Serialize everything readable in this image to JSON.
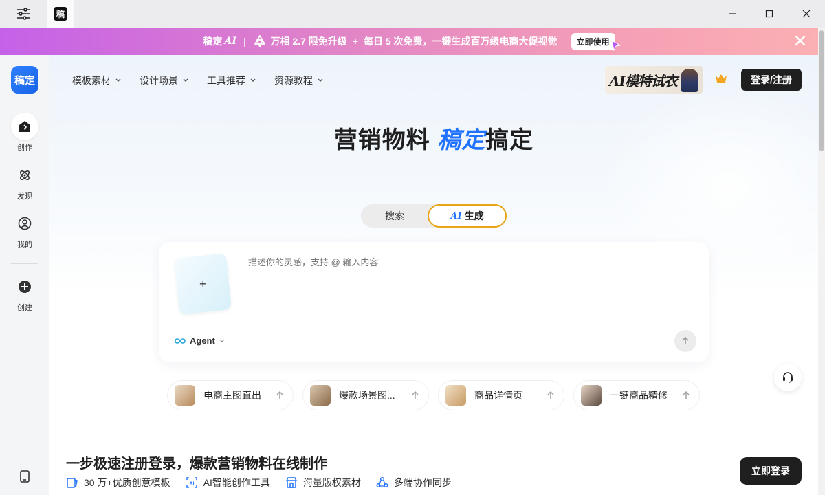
{
  "titlebar": {
    "tab_logo_text": "稿"
  },
  "banner": {
    "brand": "稿定",
    "brand_ai": "AI",
    "product": "万相 2.7 限免升级",
    "plus": "+",
    "offer": "每日 5 次免费，一键生成百万级电商大促视觉",
    "button": "立即使用"
  },
  "sidebar": {
    "logo_text": "稿定",
    "items": [
      {
        "label": "创作",
        "icon": "home-icon"
      },
      {
        "label": "发现",
        "icon": "discover-icon"
      },
      {
        "label": "我的",
        "icon": "user-icon"
      },
      {
        "label": "创建",
        "icon": "add-circle-icon"
      }
    ]
  },
  "nav": {
    "items": [
      "模板素材",
      "设计场景",
      "工具推荐",
      "资源教程"
    ],
    "promo_text": "AI模特试衣",
    "login": "登录/注册"
  },
  "hero": {
    "title_a": "营销物料 ",
    "title_b": "稿定",
    "title_c": "搞定"
  },
  "toggle": {
    "search": "搜索",
    "generate": "生成",
    "generate_prefix": "AI"
  },
  "panel": {
    "upload_plus": "+",
    "placeholder": "描述你的灵感，支持 @ 输入内容",
    "agent": "Agent"
  },
  "chips": [
    {
      "label": "电商主图直出"
    },
    {
      "label": "爆款场景图..."
    },
    {
      "label": "商品详情页"
    },
    {
      "label": "一键商品精修"
    }
  ],
  "promo": {
    "title": "一步极速注册登录，爆款营销物料在线制作",
    "features": [
      "30 万+优质创意模板",
      "AI智能创作工具",
      "海量版权素材",
      "多端协作同步"
    ],
    "button": "立即登录"
  },
  "colors": {
    "accent": "#2173ff",
    "toggle_border": "#e9a417",
    "banner_start": "#c561e8",
    "banner_end": "#fbb0b3"
  }
}
